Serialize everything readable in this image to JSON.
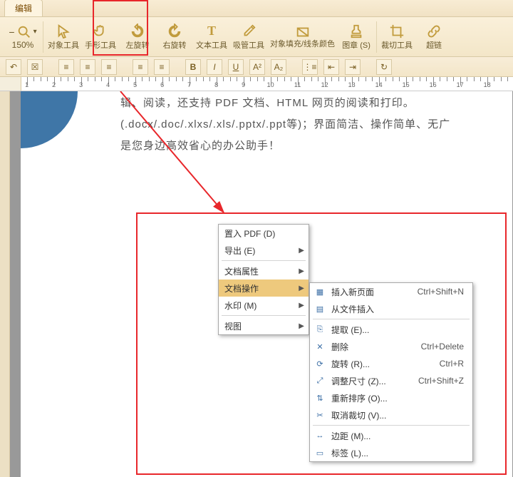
{
  "tab": {
    "label": "编辑"
  },
  "ribbon": {
    "zoomPercent": "150%",
    "buttons": [
      {
        "id": "zoom",
        "label": ""
      },
      {
        "id": "object-tool",
        "label": "对象工具"
      },
      {
        "id": "hand-tool",
        "label": "手形工具"
      },
      {
        "id": "rotate-left",
        "label": "左旋转"
      },
      {
        "id": "rotate-right",
        "label": "右旋转"
      },
      {
        "id": "text-tool",
        "label": "文本工具"
      },
      {
        "id": "eyedropper",
        "label": "吸管工具"
      },
      {
        "id": "fill-stroke",
        "label": "对象填充/线条颜色"
      },
      {
        "id": "stamp",
        "label": "图章 (S)"
      },
      {
        "id": "crop",
        "label": "裁切工具"
      },
      {
        "id": "hyperlink",
        "label": "超链"
      }
    ]
  },
  "doc": {
    "line0": "辑、阅读，还支持 PDF 文档、HTML 网页的阅读和打印。",
    "line1": "(.docx/.doc/.xlxs/.xls/.pptx/.ppt等)；界面简洁、操作简单、无广",
    "line2": "是您身边高效省心的办公助手！"
  },
  "ctxMain": {
    "items": [
      {
        "label": "置入 PDF (D)",
        "arrow": false
      },
      {
        "label": "导出 (E)",
        "arrow": true
      },
      {
        "sep": true
      },
      {
        "label": "文档属性",
        "arrow": true
      },
      {
        "label": "文档操作",
        "arrow": true,
        "hl": true
      },
      {
        "label": "水印 (M)",
        "arrow": true
      },
      {
        "sep": true
      },
      {
        "label": "视图",
        "arrow": true
      }
    ]
  },
  "ctxSub": {
    "items": [
      {
        "label": "插入新页面",
        "shortcut": "Ctrl+Shift+N"
      },
      {
        "label": "从文件插入",
        "shortcut": ""
      },
      {
        "sep": true
      },
      {
        "label": "提取 (E)...",
        "shortcut": ""
      },
      {
        "label": "删除",
        "shortcut": "Ctrl+Delete"
      },
      {
        "label": "旋转 (R)...",
        "shortcut": "Ctrl+R"
      },
      {
        "label": "调整尺寸 (Z)...",
        "shortcut": "Ctrl+Shift+Z"
      },
      {
        "label": "重新排序 (O)...",
        "shortcut": ""
      },
      {
        "label": "取消裁切 (V)...",
        "shortcut": ""
      },
      {
        "sep": true
      },
      {
        "label": "边距 (M)...",
        "shortcut": ""
      },
      {
        "label": "标签 (L)...",
        "shortcut": ""
      }
    ]
  },
  "ruler": {
    "majors": [
      1,
      2,
      3,
      4,
      5,
      6,
      7,
      8,
      9,
      10,
      11,
      12,
      13,
      14,
      15,
      16,
      17,
      18
    ]
  }
}
